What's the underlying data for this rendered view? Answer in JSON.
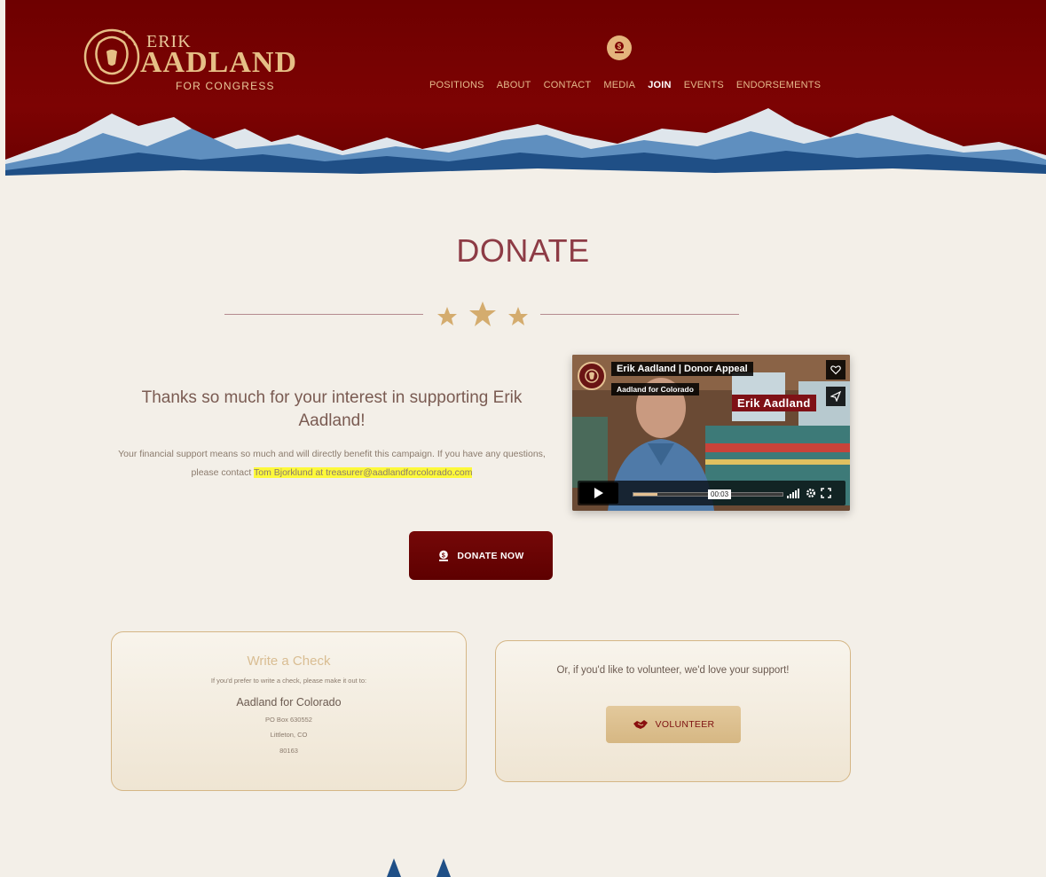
{
  "header": {
    "logo": {
      "line1": "ERIK",
      "line2": "AADLAND",
      "line3": "FOR CONGRESS"
    },
    "nav": [
      {
        "label": "POSITIONS",
        "active": false
      },
      {
        "label": "ABOUT",
        "active": false
      },
      {
        "label": "CONTACT",
        "active": false
      },
      {
        "label": "MEDIA",
        "active": false
      },
      {
        "label": "JOIN",
        "active": true
      },
      {
        "label": "EVENTS",
        "active": false
      },
      {
        "label": "ENDORSEMENTS",
        "active": false
      }
    ]
  },
  "main": {
    "title": "DONATE",
    "intro_heading": "Thanks so much for your interest in supporting Erik Aadland!",
    "intro_body": "Your financial support means so much and will directly benefit this campaign. If you have any questions, please contact ",
    "intro_highlight": "Tom Bjorklund at treasurer@aadlandforcolorado.com",
    "donate_button": "DONATE NOW"
  },
  "video": {
    "title": "Erik Aadland | Donor Appeal",
    "channel": "Aadland for Colorado",
    "overlay_name": "Erik Aadland",
    "time": "00:03",
    "progress": 0.16
  },
  "check_card": {
    "title": "Write a Check",
    "subtitle": "If you'd prefer to write a check, please make it out to:",
    "payee": "Aadland for Colorado",
    "address_line1": "PO Box 630552",
    "address_line2": "Littleton, CO",
    "address_line3": "80163"
  },
  "volunteer_card": {
    "text": "Or, if you'd like to volunteer, we'd love your support!",
    "button": "VOLUNTEER"
  },
  "colors": {
    "header_red": "#7d0303",
    "gold": "#e5c192",
    "title_maroon": "#8d3b45",
    "highlight_yellow": "#fdf93a"
  }
}
